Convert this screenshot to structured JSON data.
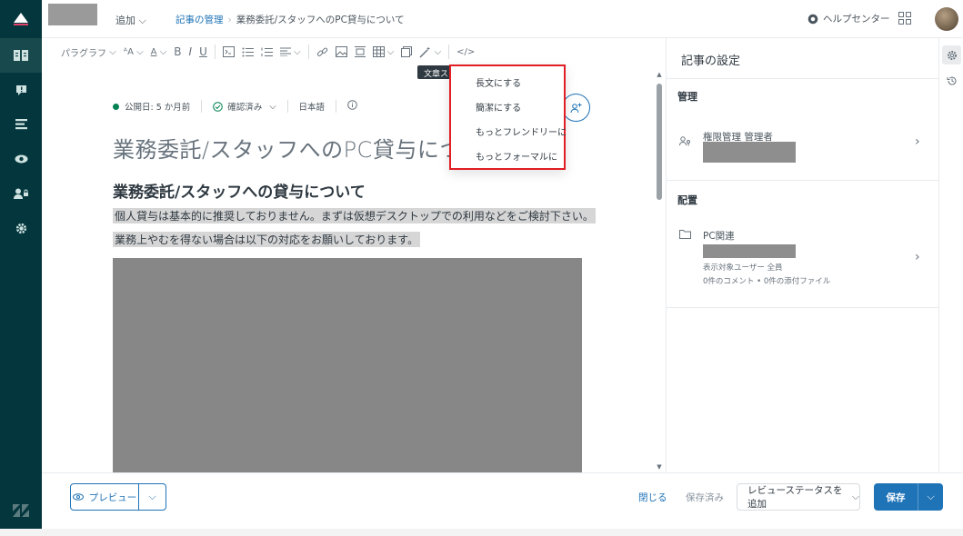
{
  "header": {
    "add_label": "追加",
    "breadcrumb_root": "記事の管理",
    "breadcrumb_current": "業務委託/スタッフへのPC貸与について",
    "help_center": "ヘルプセンター"
  },
  "toolbar": {
    "paragraph": "パラグラフ",
    "tooltip": "文章スタイル"
  },
  "dropdown": {
    "items": [
      "長文にする",
      "簡潔にする",
      "もっとフレンドリーに",
      "もっとフォーマルに"
    ]
  },
  "editor": {
    "published": "公開日: 5 か月前",
    "verified": "確認済み",
    "language": "日本語",
    "title": "業務委託/スタッフへのPC貸与について",
    "heading": "業務委託/スタッフへの貸与について",
    "para1": "個人貸与は基本的に推奨しておりません。まずは仮想デスクトップでの利用などをご検討下さい。",
    "para2": "業務上やむを得ない場合は以下の対応をお願いしております。"
  },
  "settings": {
    "title": "記事の設定",
    "manage_head": "管理",
    "manage_label": "権限管理 管理者",
    "placement_head": "配置",
    "placement_label": "PC関連",
    "visibility": "表示対象ユーザー 全員",
    "counts": "0件のコメント • 0件の添付ファイル"
  },
  "footer": {
    "preview": "プレビュー",
    "close": "閉じる",
    "saved": "保存済み",
    "review_status": "レビューステータスを追加",
    "save": "保存"
  },
  "colors": {
    "nav_bg": "#03363d",
    "accent": "#1f73b7",
    "highlight_border": "#e01e24",
    "status_green": "#038153"
  }
}
